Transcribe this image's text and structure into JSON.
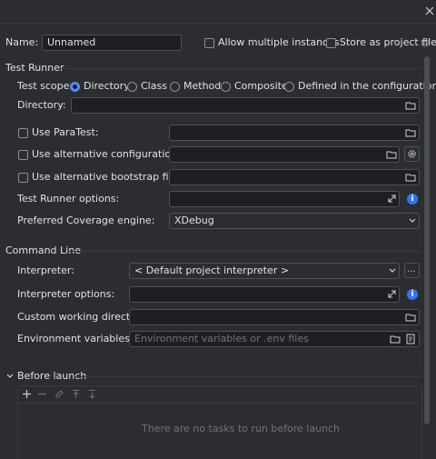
{
  "header": {
    "close_icon": "close-icon"
  },
  "config": {
    "name_label": "Name:",
    "name_value": "Unnamed",
    "allow_multiple_label": "Allow multiple instances",
    "store_project_label": "Store as project file"
  },
  "test_runner": {
    "section_title": "Test Runner",
    "scope_label": "Test scope:",
    "scopes": [
      "Directory",
      "Class",
      "Method",
      "Composite",
      "Defined in the configuration file"
    ],
    "selected_scope": "Directory",
    "directory_label": "Directory:",
    "use_paratest_label": "Use ParaTest:",
    "alt_config_label": "Use alternative configuration file:",
    "alt_bootstrap_label": "Use alternative bootstrap file:",
    "runner_options_label": "Test Runner options:",
    "coverage_label": "Preferred Coverage engine:",
    "coverage_value": "XDebug"
  },
  "command_line": {
    "section_title": "Command Line",
    "interpreter_label": "Interpreter:",
    "interpreter_value": "< Default project interpreter >",
    "interpreter_options_label": "Interpreter options:",
    "working_dir_label": "Custom working directory:",
    "env_label": "Environment variables:",
    "env_placeholder": "Environment variables or .env files"
  },
  "before_launch": {
    "section_title": "Before launch",
    "empty_text": "There are no tasks to run before launch"
  },
  "colors": {
    "accent": "#3574f0",
    "background": "#2b2d30",
    "field": "#1e1f22"
  }
}
